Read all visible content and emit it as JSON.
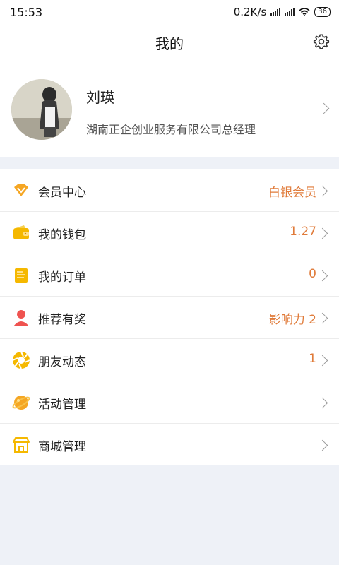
{
  "status_bar": {
    "time": "15:53",
    "network_speed": "0.2K/s",
    "battery": "36"
  },
  "header": {
    "title": "我的",
    "settings_icon": "gear-icon"
  },
  "profile": {
    "name": "刘瑛",
    "company": "湖南正企创业服务有限公司总经理"
  },
  "menu": {
    "items": [
      {
        "label": "会员中心",
        "value": "白银会员",
        "icon": "diamond-icon",
        "color": "#f5a623"
      },
      {
        "label": "我的钱包",
        "value": "1.27",
        "icon": "wallet-icon",
        "color": "#f5b800"
      },
      {
        "label": "我的订单",
        "value": "0",
        "icon": "order-icon",
        "color": "#f5b800"
      },
      {
        "label": "推荐有奖",
        "value": "影响力 2",
        "icon": "person-icon",
        "color": "#ef5350"
      },
      {
        "label": "朋友动态",
        "value": "1",
        "icon": "aperture-icon",
        "color": "#f5b800"
      },
      {
        "label": "活动管理",
        "value": "",
        "icon": "planet-icon",
        "color": "#f5a623"
      },
      {
        "label": "商城管理",
        "value": "",
        "icon": "store-icon",
        "color": "#f5b800"
      }
    ]
  },
  "colors": {
    "accent": "#e07b3a",
    "background": "#eef1f7"
  }
}
